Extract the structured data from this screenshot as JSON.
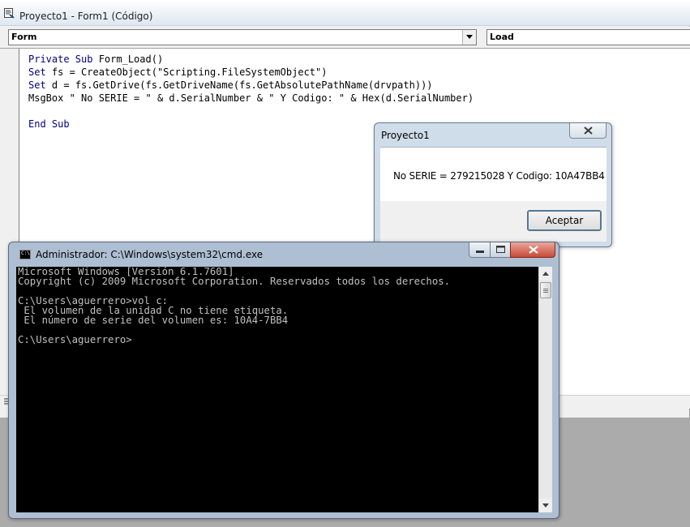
{
  "vb": {
    "title": "Proyecto1 - Form1 (Código)",
    "object_combo": "Form",
    "procedure_combo": "Load",
    "code": {
      "line1a": "Private Sub",
      "line1b": " Form_Load()",
      "line2a": "Set",
      "line2b": " fs = CreateObject(\"Scripting.FileSystemObject\")",
      "line3a": "Set",
      "line3b": " d = fs.GetDrive(fs.GetDriveName(fs.GetAbsolutePathName(drvpath)))",
      "line4": "MsgBox \" No SERIE = \" & d.SerialNumber & \" Y Codigo: \" & Hex(d.SerialNumber)",
      "line6": "End Sub"
    }
  },
  "msgbox": {
    "title": "Proyecto1",
    "message": "No SERIE = 279215028 Y Codigo: 10A47BB4",
    "ok_label": "Aceptar"
  },
  "cmd": {
    "title": "Administrador: C:\\Windows\\system32\\cmd.exe",
    "icon_text": "C:\\",
    "lines": [
      "Microsoft Windows [Versión 6.1.7601]",
      "Copyright (c) 2009 Microsoft Corporation. Reservados todos los derechos.",
      "",
      "C:\\Users\\aguerrero>vol c:",
      " El volumen de la unidad C no tiene etiqueta.",
      " El número de serie del volumen es: 10A4-7BB4",
      "",
      "C:\\Users\\aguerrero>"
    ]
  },
  "colors": {
    "keyword": "#00007f",
    "console_bg": "#000000",
    "console_fg": "#c0c0c0"
  }
}
